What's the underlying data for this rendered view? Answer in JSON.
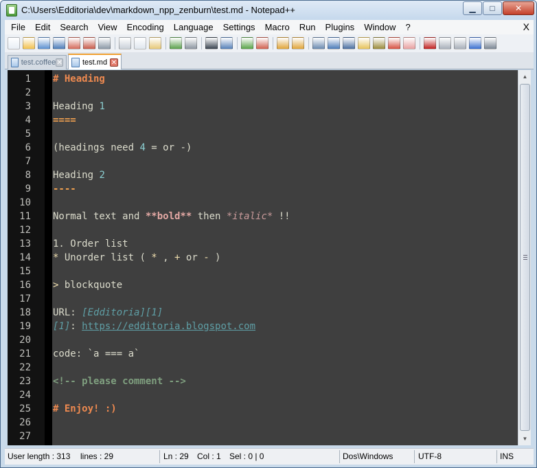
{
  "window": {
    "title": "C:\\Users\\Edditoria\\dev\\markdown_npp_zenburn\\test.md - Notepad++",
    "min_glyph": "▁",
    "max_glyph": "□",
    "close_glyph": "✕"
  },
  "menu": {
    "items": [
      "File",
      "Edit",
      "Search",
      "View",
      "Encoding",
      "Language",
      "Settings",
      "Macro",
      "Run",
      "Plugins",
      "Window",
      "?"
    ],
    "close_glyph": "X"
  },
  "toolbar": {
    "icons": [
      {
        "name": "new-file-icon",
        "color": "#e8eef5"
      },
      {
        "name": "open-file-icon",
        "color": "#f2c14e"
      },
      {
        "name": "save-icon",
        "color": "#5b8fd0"
      },
      {
        "name": "save-all-icon",
        "color": "#4b7bb8"
      },
      {
        "name": "close-icon",
        "color": "#d46a5a"
      },
      {
        "name": "close-all-icon",
        "color": "#c75a4a"
      },
      {
        "name": "print-icon",
        "color": "#8a97a6"
      },
      {
        "name": "cut-icon",
        "color": "#c9d0d8"
      },
      {
        "name": "copy-icon",
        "color": "#dfe6ee"
      },
      {
        "name": "paste-icon",
        "color": "#e7c878"
      },
      {
        "name": "undo-icon",
        "color": "#5aa04c"
      },
      {
        "name": "redo-icon",
        "color": "#8c95a0"
      },
      {
        "name": "find-icon",
        "color": "#39434f"
      },
      {
        "name": "replace-icon",
        "color": "#5580b8"
      },
      {
        "name": "zoom-in-icon",
        "color": "#58a448"
      },
      {
        "name": "zoom-out-icon",
        "color": "#d0604f"
      },
      {
        "name": "sync-vertical-icon",
        "color": "#e0a53a"
      },
      {
        "name": "sync-horizontal-icon",
        "color": "#e0a53a"
      },
      {
        "name": "word-wrap-icon",
        "color": "#6a89b0"
      },
      {
        "name": "show-all-chars-icon",
        "color": "#4a7ab8"
      },
      {
        "name": "indent-guide-icon",
        "color": "#4a6fa0"
      },
      {
        "name": "user-language-icon",
        "color": "#e7c35a"
      },
      {
        "name": "doc-map-icon",
        "color": "#9a8a3a"
      },
      {
        "name": "function-list-icon",
        "color": "#d65040"
      },
      {
        "name": "folder-workspace-icon",
        "color": "#e8a0a0"
      },
      {
        "name": "record-macro-icon",
        "color": "#c02020"
      },
      {
        "name": "stop-macro-icon",
        "color": "#a8b0ba"
      },
      {
        "name": "play-macro-icon",
        "color": "#a8b0ba"
      },
      {
        "name": "run-macro-multiple-icon",
        "color": "#3a70d0"
      },
      {
        "name": "save-macro-icon",
        "color": "#7a8694"
      }
    ]
  },
  "tabs": [
    {
      "label": "test.coffee",
      "active": false
    },
    {
      "label": "test.md",
      "active": true
    }
  ],
  "tab_close_glyph": "✕",
  "editor": {
    "colors": {
      "background": "#3f3f3f",
      "gutter": "#121212",
      "text": "#dcdccc"
    },
    "lines": [
      {
        "n": "1",
        "segs": [
          {
            "t": "# Heading",
            "c": "c-head"
          }
        ]
      },
      {
        "n": "2",
        "segs": []
      },
      {
        "n": "3",
        "segs": [
          {
            "t": "Heading ",
            "c": ""
          },
          {
            "t": "1",
            "c": "c-num"
          }
        ]
      },
      {
        "n": "4",
        "segs": [
          {
            "t": "====",
            "c": "c-orange"
          }
        ]
      },
      {
        "n": "5",
        "segs": []
      },
      {
        "n": "6",
        "segs": [
          {
            "t": "(headings need ",
            "c": ""
          },
          {
            "t": "4",
            "c": "c-num"
          },
          {
            "t": " = or -)",
            "c": ""
          }
        ]
      },
      {
        "n": "7",
        "segs": []
      },
      {
        "n": "8",
        "segs": [
          {
            "t": "Heading ",
            "c": ""
          },
          {
            "t": "2",
            "c": "c-num"
          }
        ]
      },
      {
        "n": "9",
        "segs": [
          {
            "t": "----",
            "c": "c-orange"
          }
        ]
      },
      {
        "n": "10",
        "segs": []
      },
      {
        "n": "11",
        "segs": [
          {
            "t": "Normal text and ",
            "c": ""
          },
          {
            "t": "**bold**",
            "c": "c-bold"
          },
          {
            "t": " then ",
            "c": ""
          },
          {
            "t": "*italic*",
            "c": "c-ital"
          },
          {
            "t": " !!",
            "c": ""
          }
        ]
      },
      {
        "n": "12",
        "segs": []
      },
      {
        "n": "13",
        "segs": [
          {
            "t": "1. Order list",
            "c": ""
          }
        ]
      },
      {
        "n": "14",
        "segs": [
          {
            "t": "*",
            "c": "c-bullet"
          },
          {
            "t": " Unorder list ( ",
            "c": ""
          },
          {
            "t": "*",
            "c": "c-bullet"
          },
          {
            "t": " , ",
            "c": ""
          },
          {
            "t": "+",
            "c": "c-bullet"
          },
          {
            "t": " or ",
            "c": ""
          },
          {
            "t": "-",
            "c": "c-bullet"
          },
          {
            "t": " )",
            "c": ""
          }
        ]
      },
      {
        "n": "15",
        "segs": []
      },
      {
        "n": "16",
        "segs": [
          {
            "t": ">",
            "c": "c-bullet"
          },
          {
            "t": " blockquote",
            "c": ""
          }
        ]
      },
      {
        "n": "17",
        "segs": []
      },
      {
        "n": "18",
        "segs": [
          {
            "t": "URL: ",
            "c": ""
          },
          {
            "t": "[Edditoria][1]",
            "c": "c-link"
          }
        ]
      },
      {
        "n": "19",
        "segs": [
          {
            "t": "[1]",
            "c": "c-link"
          },
          {
            "t": ": ",
            "c": ""
          },
          {
            "t": "https://edditoria.blogspot.com",
            "c": "c-url"
          }
        ]
      },
      {
        "n": "20",
        "segs": []
      },
      {
        "n": "21",
        "segs": [
          {
            "t": "code: `a === a`",
            "c": ""
          }
        ]
      },
      {
        "n": "22",
        "segs": []
      },
      {
        "n": "23",
        "segs": [
          {
            "t": "<!-- please comment -->",
            "c": "c-comment"
          }
        ]
      },
      {
        "n": "24",
        "segs": []
      },
      {
        "n": "25",
        "segs": [
          {
            "t": "# Enjoy! :)",
            "c": "c-head"
          }
        ]
      },
      {
        "n": "26",
        "segs": []
      },
      {
        "n": "27",
        "segs": []
      }
    ]
  },
  "scrollbar": {
    "up": "▲",
    "down": "▼"
  },
  "status": {
    "length": "User length : 313",
    "lines": "lines : 29",
    "ln": "Ln : 29",
    "col": "Col : 1",
    "sel": "Sel : 0 | 0",
    "eol": "Dos\\Windows",
    "encoding": "UTF-8",
    "mode": "INS"
  }
}
